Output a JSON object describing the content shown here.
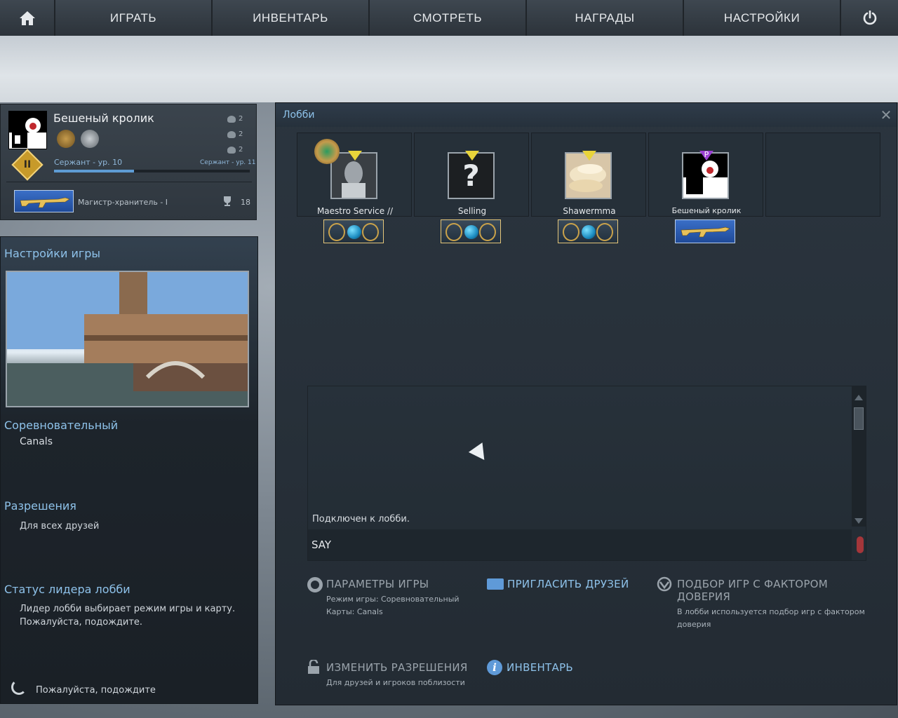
{
  "nav": {
    "items": [
      {
        "label": "ИГРАТЬ"
      },
      {
        "label": "ИНВЕНТАРЬ"
      },
      {
        "label": "СМОТРЕТЬ"
      },
      {
        "label": "НАГРАДЫ"
      },
      {
        "label": "НАСТРОЙКИ"
      }
    ]
  },
  "profile": {
    "name": "Бешеный кролик",
    "stats": [
      "2",
      "2",
      "2"
    ],
    "rank_current": "Сержант - ур. 10",
    "rank_next": "Сержант - ур. 11",
    "xp_progress": 0.41,
    "skill_group": "Магистр-хранитель - I",
    "trophies": "18"
  },
  "settings": {
    "title": "Настройки игры",
    "mode_title": "Соревновательный",
    "map": "Canals",
    "permissions_title": "Разрешения",
    "permissions_value": "Для всех друзей",
    "leader_title": "Статус лидера лобби",
    "leader_line1": "Лидер лобби выбирает режим игры и карту.",
    "leader_line2": "Пожалуйста, подождите.",
    "waiting": "Пожалуйста, подождите"
  },
  "lobby": {
    "title": "Лобби",
    "players": [
      {
        "name": "Maestro Service //",
        "tag_color": "#e9d43a"
      },
      {
        "name": "Selling",
        "tag_color": "#e9d43a"
      },
      {
        "name": "Shawermma",
        "tag_color": "#e9d43a"
      },
      {
        "name": "Бешеный кролик",
        "tag_color": "#9b3fd3",
        "tag_letter": "P"
      }
    ],
    "chat_message": "Подключен к лобби.",
    "chat_placeholder": "SAY"
  },
  "actions": {
    "game_params": {
      "title": "ПАРАМЕТРЫ ИГРЫ",
      "line1": "Режим игры: Соревновательный",
      "line2": "Карты: Canals"
    },
    "invite": {
      "title": "ПРИГЛАСИТЬ ДРУЗЕЙ"
    },
    "trust": {
      "title": "ПОДБОР ИГР С ФАКТОРОМ ДОВЕРИЯ",
      "line1": "В лобби используется подбор игр с фактором",
      "line2": "доверия"
    },
    "permissions": {
      "title": "ИЗМЕНИТЬ РАЗРЕШЕНИЯ",
      "line1": "Для друзей и игроков поблизости"
    },
    "inventory": {
      "title": "ИНВЕНТАРЬ"
    }
  },
  "colors": {
    "accent": "#8ec2ea",
    "panel": "#232b33",
    "tag_gold": "#e9d43a",
    "tag_prime": "#9b3fd3"
  }
}
